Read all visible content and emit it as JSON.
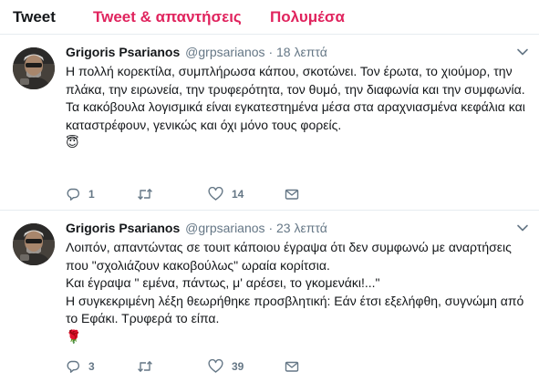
{
  "tabs": [
    {
      "label": "Tweet"
    },
    {
      "label": "Tweet & απαντήσεις"
    },
    {
      "label": "Πολυμέσα"
    }
  ],
  "colors": {
    "accent": "#e0245e",
    "muted": "#657786",
    "text": "#14171a",
    "border": "#e6ecf0"
  },
  "tweets": [
    {
      "name": "Grigoris Psarianos",
      "handle": "@grpsarianos",
      "separator": "·",
      "time": "18 λεπτά",
      "lines": [
        "Η πολλή κορεκτίλα, συμπλήρωσα κάπου, σκοτώνει. Τον έρωτα, το χιούμορ, την πλάκα, την ειρωνεία, την τρυφερότητα, τον θυμό, την διαφωνία και την συμφωνία.",
        "Τα κακόβουλα λογισμικά είναι εγκατεστημένα μέσα στα αραχνιασμένα κεφάλια και καταστρέφουν, γενικώς και όχι μόνο τους φορείς."
      ],
      "emoji": "😇",
      "replies": "1",
      "retweets": "",
      "likes": "14"
    },
    {
      "name": "Grigoris Psarianos",
      "handle": "@grpsarianos",
      "separator": "·",
      "time": "23 λεπτά",
      "lines": [
        "Λοιπόν, απαντώντας σε τουιτ κάποιου έγραψα ότι δεν συμφωνώ με αναρτήσεις που \"σχολιάζουν κακοβούλως\" ωραία κορίτσια.",
        "Και έγραψα \" εμένα, πάντως, μ' αρέσει, το γκομενάκι!...\"",
        "Η συγκεκριμένη λέξη θεωρήθηκε προσβλητική: Εάν έτσι εξελήφθη, συγνώμη από το Εφάκι. Τρυφερά το είπα."
      ],
      "emoji": "🌹",
      "replies": "3",
      "retweets": "",
      "likes": "39"
    }
  ]
}
